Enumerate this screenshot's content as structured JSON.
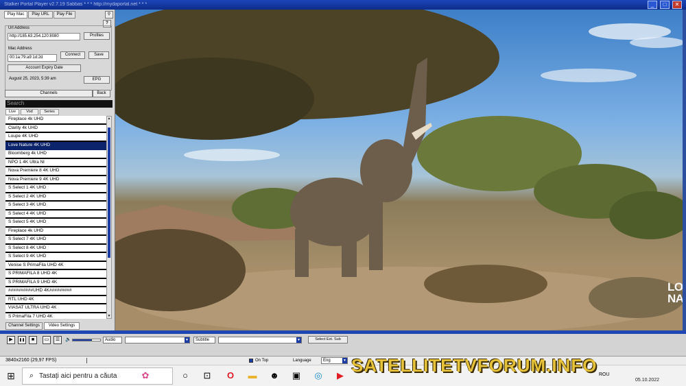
{
  "window": {
    "title": "Stalker Portal Player v2.7.19 Sabbas * * * http://mydaportal.net * * *",
    "minimize": "_",
    "maximize": "□",
    "close": "✕"
  },
  "panel": {
    "tabs": [
      "Play Mac",
      "Play URL",
      "Play File"
    ],
    "help": "?",
    "portal_label": "Url Address",
    "portal_url": "http://185.63.254.120:8080",
    "profiles_button": "Profiles",
    "mac_label": "Mac Address",
    "mac_value": "00:1a:79:a9:1d:2d",
    "connect_button": "Connect",
    "save_button": "Save",
    "expiry_label": "Account Expiry Date",
    "expiry_value": "August 25, 2023, 5:39 am",
    "epg_button": "EPG",
    "channels_button": "Channels",
    "back_button": "Back",
    "search_placeholder": "Search",
    "subtabs": [
      "Live",
      "Vod",
      "Series"
    ],
    "channels": [
      "Fireplace 4k UHD",
      "Clarity 4k UHD",
      "Loupe 4K UHD",
      "Love Nature 4K UHD",
      "Bloomberg 4k UHD",
      "NPO 1 4K Ultra Nl",
      "Nova Premiere 8 4K UHD",
      "Nova Premiere 9 4K UHD",
      "S Select 1 4K UHD",
      "S Select 2 4K UHD",
      "S Select 3 4K UHD",
      "S Select 4 4K UHD",
      "S Select 5 4K UHD",
      "Fireplace 4k UHD",
      "S Select 7 4K UHD",
      "S Select 8 4K UHD",
      "S Select 9 4K UHD",
      "Venise S PrimaFila UHD 4K",
      "S PRIMAFILA 8 UHD 4K",
      "S PRIMAFILA 9 UHD 4K",
      "##########UHD 4K#########",
      "RTL UHD 4K",
      "VIASAT ULTRA UHD 4K",
      "S PrimaFila 7 UHD 4K"
    ],
    "selected_index": 3,
    "bottom_tabs": [
      "Channel Settings",
      "Video Settings"
    ]
  },
  "video": {
    "channel_logo": [
      "LOVE",
      "NATURE"
    ]
  },
  "controls": {
    "play": "▶",
    "pause": "❚❚",
    "stop": "■",
    "screen": "▭",
    "list": "☰",
    "volume_icon": "🔈",
    "volume_level": 0.7,
    "audio_label": "Audio",
    "subtitle_label": "Subtitle",
    "select_sub_button": "Select Ext. Sub"
  },
  "status": {
    "resolution": "3840x2160  (29,97 FPS)",
    "on_top": "On Top",
    "language_label": "Language",
    "language_value": "Eng"
  },
  "taskbar": {
    "start_icon": "windows-logo-icon",
    "search_placeholder": "Tastați aici pentru a căuta",
    "lang": "ROU",
    "date": "05.10.2022"
  },
  "watermark": "SATELLITETVFORUM.INFO",
  "colors": {
    "title_bar": "#1c45b8",
    "selection": "#0b246b",
    "watermark": "#e6c13a"
  }
}
